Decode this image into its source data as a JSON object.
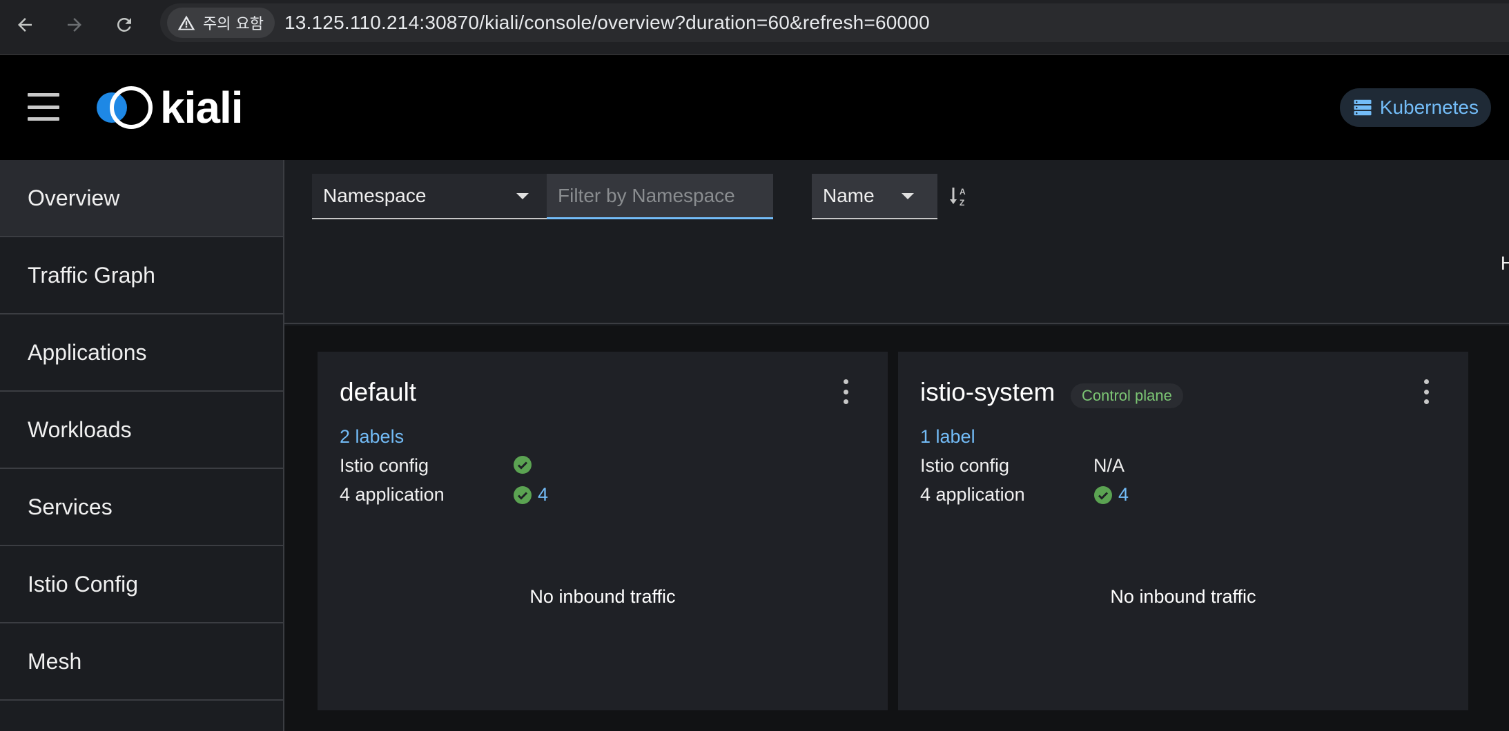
{
  "browser": {
    "security_label": "주의 요함",
    "url_host": "13.125.110.214",
    "url_rest": ":30870/kiali/console/overview?duration=60&refresh=60000"
  },
  "masthead": {
    "logo_text": "kiali",
    "cluster_label": "Kubernetes"
  },
  "sidebar": {
    "items": [
      {
        "label": "Overview",
        "active": true
      },
      {
        "label": "Traffic Graph"
      },
      {
        "label": "Applications"
      },
      {
        "label": "Workloads"
      },
      {
        "label": "Services"
      },
      {
        "label": "Istio Config"
      },
      {
        "label": "Mesh"
      }
    ]
  },
  "toolbar": {
    "filter_type": "Namespace",
    "filter_placeholder": "Filter by Namespace",
    "sort_field": "Name",
    "clipped_text": "H"
  },
  "cards": [
    {
      "name": "default",
      "labels": "2 labels",
      "istio_config_label": "Istio config",
      "istio_config_status": "ok",
      "apps_label": "4 application",
      "apps_count": "4",
      "traffic": "No inbound traffic"
    },
    {
      "name": "istio-system",
      "badge": "Control plane",
      "labels": "1 label",
      "istio_config_label": "Istio config",
      "istio_config_value": "N/A",
      "apps_label": "4 application",
      "apps_count": "4",
      "traffic": "No inbound traffic"
    }
  ],
  "colors": {
    "link": "#73bcf7",
    "success": "#3e8635",
    "control_plane": "#7cc674"
  },
  "icons": [
    "back-arrow-icon",
    "forward-arrow-icon",
    "reload-icon",
    "warning-icon",
    "hamburger-icon",
    "server-icon",
    "sort-alpha-icon",
    "kebab-icon",
    "check-circle-icon"
  ]
}
